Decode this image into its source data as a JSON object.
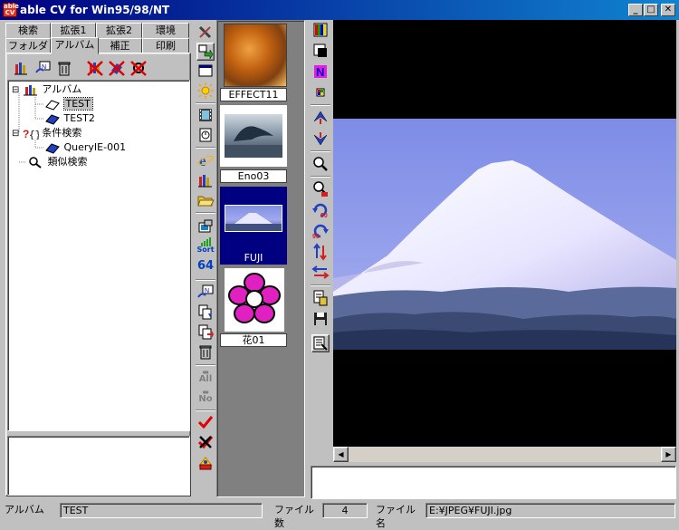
{
  "window": {
    "title": "able CV for Win95/98/NT",
    "icon_text": "able CV",
    "minimize_label": "_",
    "maximize_label": "□",
    "close_label": "✕"
  },
  "tabs": {
    "row1": [
      {
        "label": "検索"
      },
      {
        "label": "拡張1"
      },
      {
        "label": "拡張2"
      },
      {
        "label": "環境"
      }
    ],
    "row2": [
      {
        "label": "フォルダ"
      },
      {
        "label": "アルバム",
        "active": true
      },
      {
        "label": "補正"
      },
      {
        "label": "印刷"
      }
    ]
  },
  "tree": {
    "nodes": [
      {
        "label": "アルバム",
        "expander": "⊟"
      },
      {
        "label": "TEST",
        "selected": true
      },
      {
        "label": "TEST2"
      },
      {
        "label": "条件検索",
        "expander": "⊟"
      },
      {
        "label": "QueryIE-001"
      },
      {
        "label": "類似検索"
      }
    ]
  },
  "thumbnails": [
    {
      "label": "EFFECT11",
      "selected": false
    },
    {
      "label": "Eno03",
      "selected": false
    },
    {
      "label": "FUJI",
      "selected": true
    },
    {
      "label": "花01",
      "selected": false
    }
  ],
  "toolbar_text": {
    "sort": "Sort",
    "count64": "64",
    "all": "All",
    "no": "No"
  },
  "statusbar": {
    "album_label": "アルバム",
    "album_value": "TEST",
    "file_count_label": "ファイル数",
    "file_count_value": "4",
    "file_name_label": "ファイル名",
    "file_name_value": "E:¥JPEG¥FUJI.jpg"
  },
  "colors": {
    "titlebar_start": "#000080",
    "titlebar_end": "#1084d0",
    "face": "#c0c0c0",
    "selection": "#000080"
  }
}
